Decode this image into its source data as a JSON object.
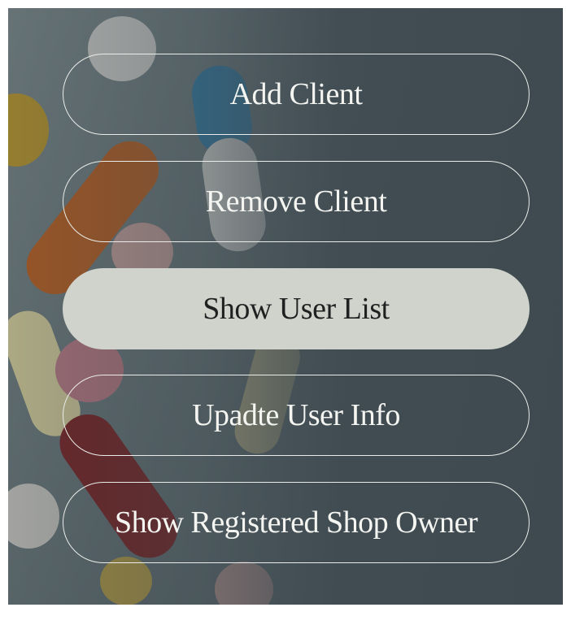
{
  "background": {
    "image_name": "medicine-pills-background",
    "overlay_color": "#3e4a50"
  },
  "menu": {
    "items": [
      {
        "label": "Add Client",
        "active": false
      },
      {
        "label": "Remove Client",
        "active": false
      },
      {
        "label": "Show User List",
        "active": true
      },
      {
        "label": "Upadte User Info",
        "active": false
      },
      {
        "label": "Show Registered Shop Owner",
        "active": false
      }
    ]
  },
  "colors": {
    "button_border": "#e9ece8",
    "button_text": "#f4f5f1",
    "active_button_bg": "#cfd3cc",
    "active_button_text": "#1e2120"
  }
}
